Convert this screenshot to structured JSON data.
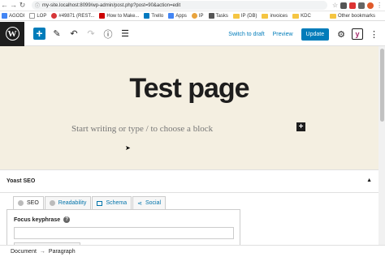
{
  "browser": {
    "url": "my-site.localhost:8099/wp-admin/post.php?post=90&action=edit",
    "bookmarks": [
      {
        "label": "AGODI",
        "color": "#4285f4"
      },
      {
        "label": "LOP",
        "color": "#e8e8e8"
      },
      {
        "label": "#49871 (REST...",
        "color": "#d63638"
      },
      {
        "label": "How to Make...",
        "color": "#c00"
      },
      {
        "label": "Trello",
        "color": "#0079bf"
      },
      {
        "label": "Apps",
        "color": "#4285f4"
      },
      {
        "label": "IP",
        "color": "#e8a33d"
      },
      {
        "label": "Tasks",
        "color": "#555"
      },
      {
        "label": "IP (DB)",
        "color": "#f5c542"
      },
      {
        "label": "invoices",
        "color": "#f5c542"
      },
      {
        "label": "KDC",
        "color": "#f5c542"
      }
    ],
    "other_bookmarks": "Other bookmarks"
  },
  "toolbar": {
    "switch_to_draft": "Switch to draft",
    "preview": "Preview",
    "update": "Update",
    "yoast_label": "y"
  },
  "editor": {
    "title": "Test page",
    "placeholder": "Start writing or type / to choose a block"
  },
  "yoast": {
    "heading": "Yoast SEO",
    "tabs": [
      {
        "label": "SEO"
      },
      {
        "label": "Readability"
      },
      {
        "label": "Schema"
      },
      {
        "label": "Social"
      }
    ],
    "focus_keyphrase_label": "Focus keyphrase",
    "help": "?"
  },
  "breadcrumb": {
    "document": "Document",
    "separator": "→",
    "current": "Paragraph"
  },
  "colors": {
    "accent": "#007cba",
    "canvas_bg": "#f4efe1",
    "wp_logo_bg": "#1e1e1e"
  }
}
